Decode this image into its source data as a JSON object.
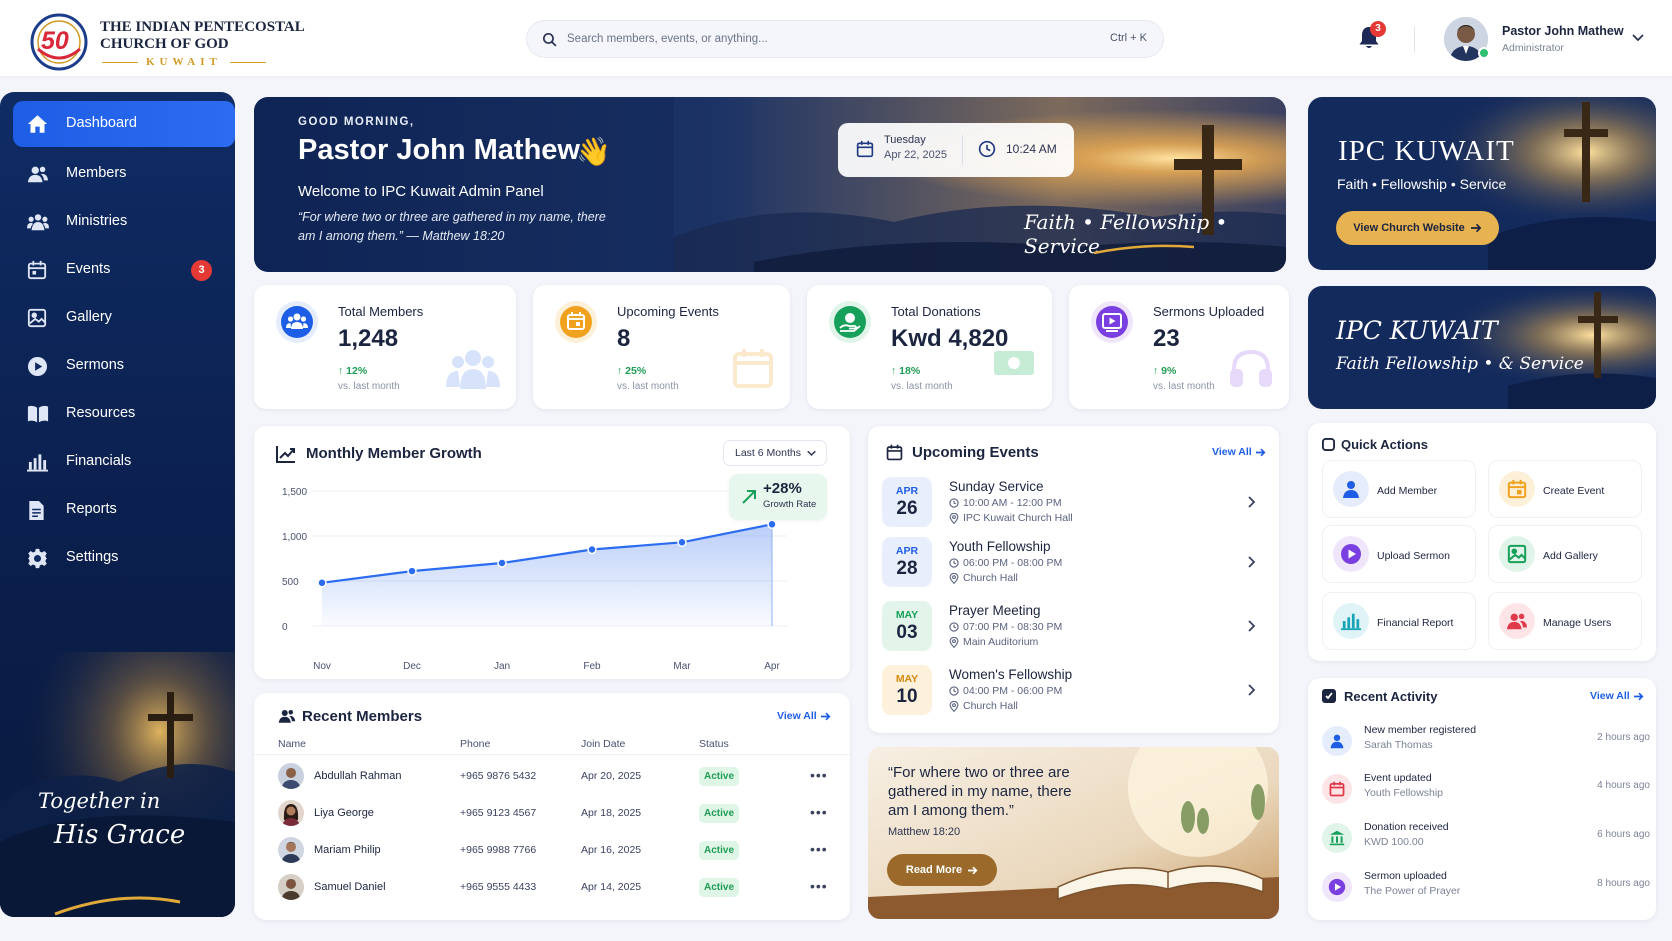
{
  "header": {
    "org_line1": "THE INDIAN PENTECOSTAL",
    "org_line2": "CHURCH OF GOD",
    "org_line3": "KUWAIT",
    "logo_number": "50",
    "search_placeholder": "Search members, events, or anything...",
    "search_shortcut": "Ctrl + K",
    "notification_count": "3",
    "user_name": "Pastor John Mathew",
    "user_role": "Administrator"
  },
  "sidebar": {
    "items": [
      {
        "label": "Dashboard",
        "icon": "home-icon"
      },
      {
        "label": "Members",
        "icon": "users-icon"
      },
      {
        "label": "Ministries",
        "icon": "group-icon"
      },
      {
        "label": "Events",
        "icon": "calendar-icon",
        "badge": "3"
      },
      {
        "label": "Gallery",
        "icon": "image-icon"
      },
      {
        "label": "Sermons",
        "icon": "play-icon"
      },
      {
        "label": "Resources",
        "icon": "book-icon"
      },
      {
        "label": "Financials",
        "icon": "chart-icon"
      },
      {
        "label": "Reports",
        "icon": "document-icon"
      },
      {
        "label": "Settings",
        "icon": "gear-icon"
      }
    ],
    "quote_line1": "Together in",
    "quote_line2": "His Grace"
  },
  "hero": {
    "greeting": "GOOD MORNING,",
    "name": "Pastor John Mathew",
    "emoji": "👋",
    "welcome": "Welcome to IPC Kuwait Admin Panel",
    "verse": "“For where two or three are gathered in my name, there am I among them.” — Matthew 18:20",
    "day": "Tuesday",
    "date": "Apr 22, 2025",
    "time": "10:24 AM",
    "tagline": "Faith • Fellowship • Service"
  },
  "banner1": {
    "title": "IPC KUWAIT",
    "subtitle": "Faith • Fellowship • Service",
    "button": "View Church Website"
  },
  "banner2": {
    "title": "IPC KUWAIT",
    "subtitle": "Faith Fellowship • & Service"
  },
  "stats": [
    {
      "title": "Total Members",
      "value": "1,248",
      "change": "12%",
      "sub": "vs. last month",
      "color": "#1e5ee6"
    },
    {
      "title": "Upcoming Events",
      "value": "8",
      "change": "25%",
      "sub": "vs. last month",
      "color": "#f0a21e"
    },
    {
      "title": "Total Donations",
      "value": "Kwd 4,820",
      "change": "18%",
      "sub": "vs. last month",
      "color": "#17a05a"
    },
    {
      "title": "Sermons Uploaded",
      "value": "23",
      "change": "9%",
      "sub": "vs. last month",
      "color": "#7a3fe0"
    }
  ],
  "growth": {
    "title": "Monthly Member Growth",
    "range": "Last 6 Months",
    "rate": "+28%",
    "rate_label": "Growth Rate"
  },
  "chart_data": {
    "type": "area",
    "categories": [
      "Nov",
      "Dec",
      "Jan",
      "Feb",
      "Mar",
      "Apr"
    ],
    "values": [
      480,
      610,
      700,
      850,
      930,
      1130
    ],
    "title": "Monthly Member Growth",
    "xlabel": "",
    "ylabel": "",
    "ylim": [
      0,
      1500
    ],
    "yticks": [
      "0",
      "500",
      "1,000",
      "1,500"
    ],
    "grid": true,
    "color": "#2c6cf1"
  },
  "members": {
    "title": "Recent Members",
    "view_all": "View All",
    "columns": [
      "Name",
      "Phone",
      "Join Date",
      "Status"
    ],
    "rows": [
      {
        "name": "Abdullah Rahman",
        "phone": "+965 9876 5432",
        "date": "Apr 20, 2025",
        "status": "Active"
      },
      {
        "name": "Liya George",
        "phone": "+965 9123 4567",
        "date": "Apr 18, 2025",
        "status": "Active"
      },
      {
        "name": "Mariam Philip",
        "phone": "+965 9988 7766",
        "date": "Apr 16, 2025",
        "status": "Active"
      },
      {
        "name": "Samuel Daniel",
        "phone": "+965 9555 4433",
        "date": "Apr 14, 2025",
        "status": "Active"
      }
    ]
  },
  "events": {
    "title": "Upcoming Events",
    "view_all": "View All",
    "items": [
      {
        "month": "APR",
        "day": "26",
        "name": "Sunday Service",
        "time": "10:00 AM - 12:00 PM",
        "place": "IPC Kuwait Church Hall",
        "color": "#1e5ee6",
        "bg": "#e8eefc"
      },
      {
        "month": "APR",
        "day": "28",
        "name": "Youth Fellowship",
        "time": "06:00 PM - 08:00 PM",
        "place": "Church Hall",
        "color": "#1e5ee6",
        "bg": "#e8eefc"
      },
      {
        "month": "MAY",
        "day": "03",
        "name": "Prayer Meeting",
        "time": "07:00 PM - 08:30 PM",
        "place": "Main Auditorium",
        "color": "#17a05a",
        "bg": "#e3f5ea"
      },
      {
        "month": "MAY",
        "day": "10",
        "name": "Women's Fellowship",
        "time": "04:00 PM - 06:00 PM",
        "place": "Church Hall",
        "color": "#d48a10",
        "bg": "#fdf1dc"
      }
    ]
  },
  "verse_card": {
    "quote": "“For where two or three are gathered in my name, there am I among them.”",
    "ref": "Matthew 18:20",
    "button": "Read More"
  },
  "quick_actions": {
    "title": "Quick Actions",
    "items": [
      {
        "label": "Add Member",
        "color": "#1e5ee6",
        "bg": "#e5edfd"
      },
      {
        "label": "Create Event",
        "color": "#f0a21e",
        "bg": "#fdf0d8"
      },
      {
        "label": "Upload Sermon",
        "color": "#7a3fe0",
        "bg": "#efe6fc"
      },
      {
        "label": "Add Gallery",
        "color": "#17a05a",
        "bg": "#e1f4e9"
      },
      {
        "label": "Financial Report",
        "color": "#1aa3b8",
        "bg": "#e0f4f7"
      },
      {
        "label": "Manage Users",
        "color": "#e0394a",
        "bg": "#fde5e7"
      }
    ]
  },
  "activity": {
    "title": "Recent Activity",
    "view_all": "View All",
    "items": [
      {
        "title": "New member registered",
        "sub": "Sarah Thomas",
        "time": "2 hours ago",
        "color": "#1e5ee6",
        "bg": "#e5edfd"
      },
      {
        "title": "Event updated",
        "sub": "Youth Fellowship",
        "time": "4 hours ago",
        "color": "#e0394a",
        "bg": "#fde5e7"
      },
      {
        "title": "Donation received",
        "sub": "KWD 100.00",
        "time": "6 hours ago",
        "color": "#17a05a",
        "bg": "#e1f4e9"
      },
      {
        "title": "Sermon uploaded",
        "sub": "The Power of Prayer",
        "time": "8 hours ago",
        "color": "#7a3fe0",
        "bg": "#efe6fc"
      }
    ]
  }
}
